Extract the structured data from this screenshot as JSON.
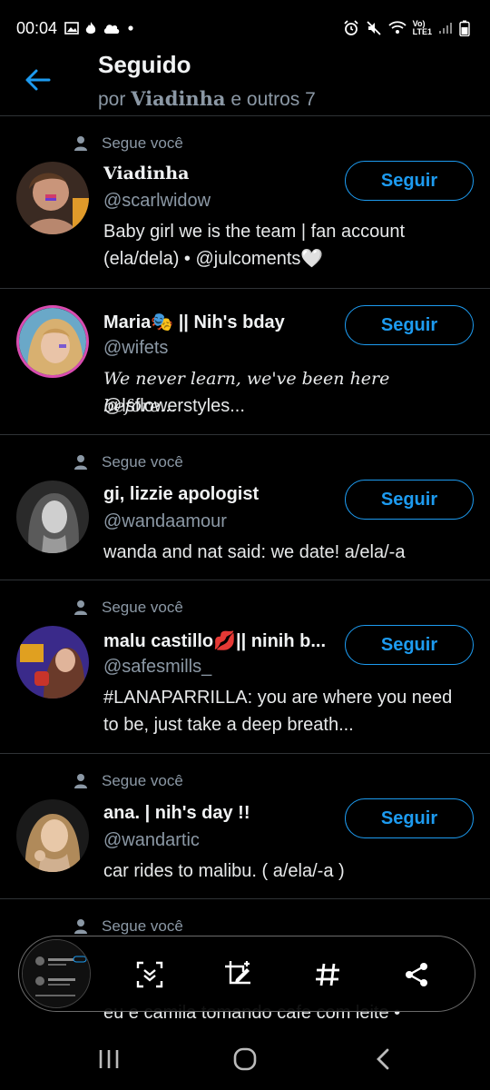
{
  "status_bar": {
    "time": "00:04",
    "network": "Vo)\nLTE1"
  },
  "header": {
    "title": "Seguido",
    "subtitle_prefix": "por",
    "subtitle_name": "Viadinha",
    "subtitle_suffix": "e outros 7"
  },
  "users": [
    {
      "follows_you": "Segue você",
      "name": "Viadinha",
      "handle": "@scarlwidow",
      "bio": "Baby girl we is the team | fan account (ela/dela) • @julcoments🤍",
      "button": "Seguir"
    },
    {
      "follows_you": "",
      "name": "Maria🎭 || Nih's bday",
      "handle": "@wifets",
      "bio_line1": "We never learn, we've been here before...",
      "bio_line2": "@lsflowerstyles...",
      "button": "Seguir"
    },
    {
      "follows_you": "Segue você",
      "name": "gi, lizzie apologist",
      "handle": "@wandaamour",
      "bio": "wanda and nat said: we date! a/ela/-a",
      "button": "Seguir"
    },
    {
      "follows_you": "Segue você",
      "name": "malu castillo💋|| ninih b...",
      "handle": "@safesmills_",
      "bio": "#LANAPARRILLA: you are where you need to be, just take a deep breath...",
      "button": "Seguir"
    },
    {
      "follows_you": "Segue você",
      "name": "ana. | nih's day !!",
      "handle": "@wandartic",
      "bio": "car rides to malibu. ( a/ela/-a )",
      "button": "Seguir"
    },
    {
      "follows_you": "Segue você",
      "bio": "eu e camila tomando cafe com leite •"
    }
  ],
  "colors": {
    "accent": "#1d9bf0",
    "background": "#000000",
    "divider": "#2f3336",
    "muted": "#8b98a5"
  }
}
